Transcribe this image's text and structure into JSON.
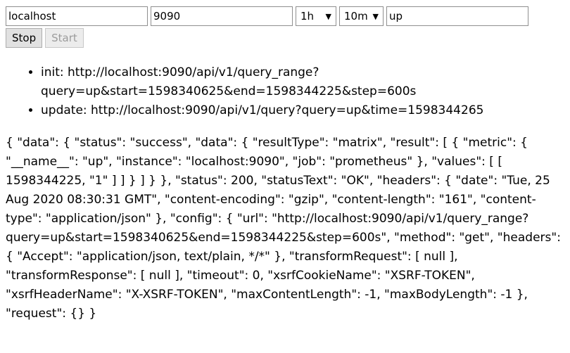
{
  "controls": {
    "host": "localhost",
    "port": "9090",
    "range": "1h",
    "step": "10m",
    "query": "up",
    "stop_label": "Stop",
    "start_label": "Start"
  },
  "log": [
    "init: http://localhost:9090/api/v1/query_range?query=up&start=1598340625&end=1598344225&step=600s",
    "update: http://localhost:9090/api/v1/query?query=up&time=1598344265"
  ],
  "response": "{ \"data\": { \"status\": \"success\", \"data\": { \"resultType\": \"matrix\", \"result\": [ { \"metric\": { \"__name__\": \"up\", \"instance\": \"localhost:9090\", \"job\": \"prometheus\" }, \"values\": [ [ 1598344225, \"1\" ] ] } ] } }, \"status\": 200, \"statusText\": \"OK\", \"headers\": { \"date\": \"Tue, 25 Aug 2020 08:30:31 GMT\", \"content-encoding\": \"gzip\", \"content-length\": \"161\", \"content-type\": \"application/json\" }, \"config\": { \"url\": \"http://localhost:9090/api/v1/query_range?query=up&start=1598340625&end=1598344225&step=600s\", \"method\": \"get\", \"headers\": { \"Accept\": \"application/json, text/plain, */*\" }, \"transformRequest\": [ null ], \"transformResponse\": [ null ], \"timeout\": 0, \"xsrfCookieName\": \"XSRF-TOKEN\", \"xsrfHeaderName\": \"X-XSRF-TOKEN\", \"maxContentLength\": -1, \"maxBodyLength\": -1 }, \"request\": {} }"
}
